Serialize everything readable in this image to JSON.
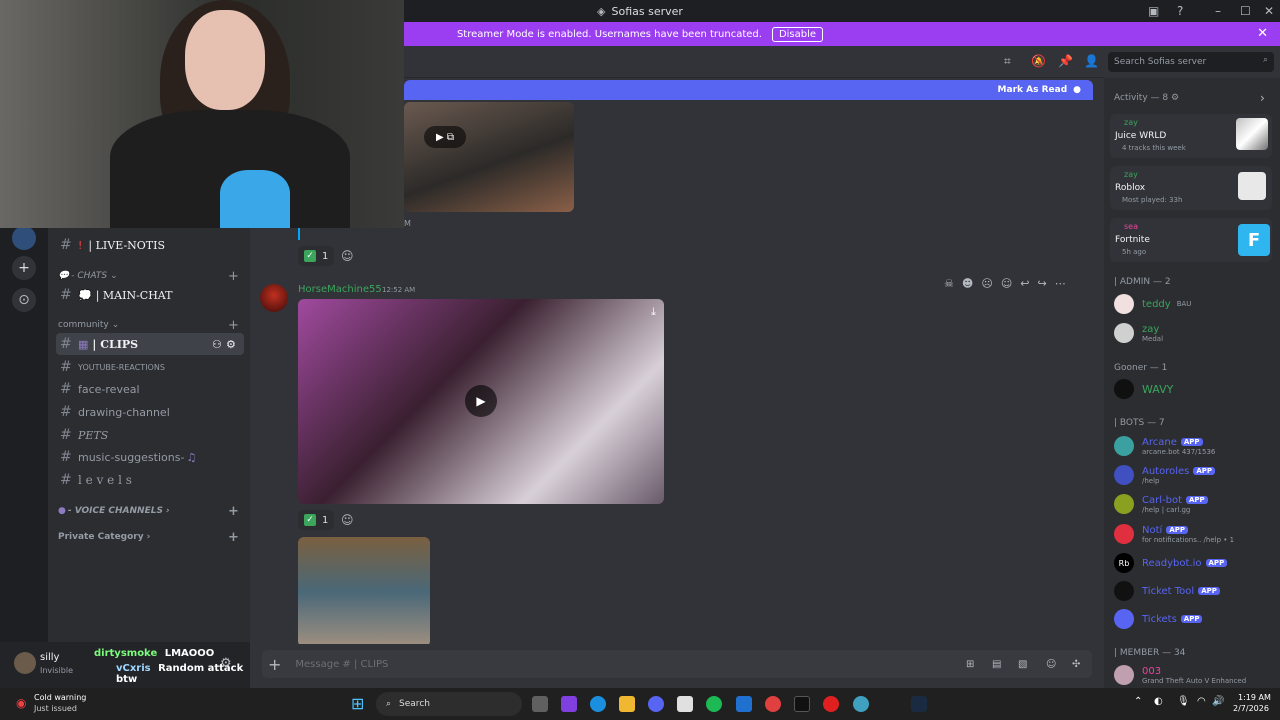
{
  "window": {
    "title": "Sofias server"
  },
  "notice": {
    "text": "Streamer Mode is enabled. Usernames have been truncated.",
    "button": "Disable"
  },
  "banner": {
    "mark_read": "Mark As Read"
  },
  "search": {
    "placeholder": "Search Sofias server"
  },
  "sidebar": {
    "live_notis": "| LIVE-NOTIS",
    "chats_cat": "- CHATS",
    "main_chat": "| MAIN-CHAT",
    "community_cat": "community",
    "clips": "| CLIPS",
    "youtube": "YOUTUBE-REACTIONS",
    "face_reveal": "face-reveal",
    "drawing": "drawing-channel",
    "pets": "PETS",
    "music": "music-suggestions-",
    "levels": "l e v e l s",
    "voice_cat": "- VOICE CHANNELS",
    "private_cat": "Private Category"
  },
  "user_panel": {
    "name": "silly",
    "status": "Invisible",
    "overlay1_name": "dirtysmoke",
    "overlay1_msg": "LMAOOO",
    "overlay2_name": "vCxris",
    "overlay2_msg": "Random attack btw"
  },
  "messages": {
    "author": "HorseMachine55",
    "time": "12:52 AM",
    "partial_time": "M",
    "reaction_count_1": "1",
    "reaction_count_2": "1"
  },
  "composer": {
    "placeholder": "Message # | CLIPS"
  },
  "members": {
    "activity_header": "Activity — 8",
    "activities": [
      {
        "user": "zay",
        "title": "Juice WRLD",
        "sub": "4 tracks this week"
      },
      {
        "user": "zay",
        "title": "Roblox",
        "sub": "Most played: 33h"
      },
      {
        "user": "sea",
        "title": "Fortnite",
        "sub": "5h ago"
      }
    ],
    "admin_header": "| ADMIN — 2",
    "admins": [
      {
        "name": "teddy",
        "sub": "BAU",
        "color": "#3ba55c"
      },
      {
        "name": "zay",
        "sub": "Medal",
        "color": "#3ba55c"
      }
    ],
    "gooner_header": "Gooner — 1",
    "gooners": [
      {
        "name": "WAVY",
        "color": "#3ba55c"
      }
    ],
    "bots_header": "| BOTS — 7",
    "bots": [
      {
        "name": "Arcane",
        "sub": "arcane.bot 437/1536",
        "color": "#5865f2"
      },
      {
        "name": "Autoroles",
        "sub": "/help",
        "color": "#5865f2"
      },
      {
        "name": "Carl-bot",
        "sub": "/help | carl.gg",
        "color": "#5865f2"
      },
      {
        "name": "Notí",
        "sub": "for notifications.. /help • 1",
        "color": "#5865f2"
      },
      {
        "name": "Readybot.io",
        "sub": "",
        "color": "#5865f2"
      },
      {
        "name": "Ticket Tool",
        "sub": "",
        "color": "#5865f2"
      },
      {
        "name": "Tickets",
        "sub": "",
        "color": "#5865f2"
      }
    ],
    "app_label": "APP",
    "member_header": "| MEMBER — 34",
    "member_first": {
      "name": "003",
      "sub": "Grand Theft Auto V Enhanced",
      "color": "#eb459e"
    }
  },
  "taskbar": {
    "weather_title": "Cold warning",
    "weather_sub": "Just issued",
    "search": "Search",
    "time": "1:19 AM",
    "date": "2/7/2026"
  },
  "colors": {
    "accent": "#5865f2",
    "streamer": "#9b3ef2",
    "online": "#3ba55c"
  }
}
